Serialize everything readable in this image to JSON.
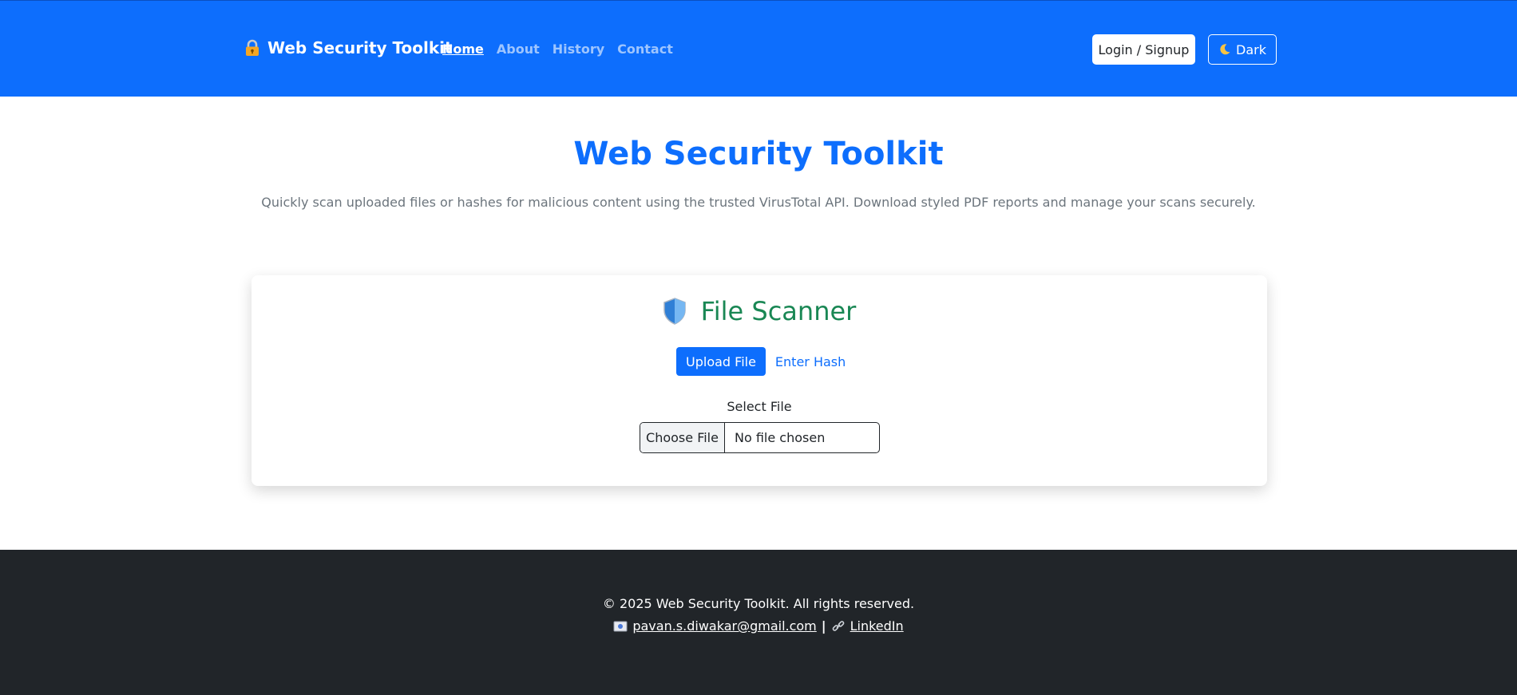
{
  "navbar": {
    "brand": "Web Security Toolkit",
    "links": [
      {
        "label": "Home",
        "active": true
      },
      {
        "label": "About",
        "active": false
      },
      {
        "label": "History",
        "active": false
      },
      {
        "label": "Contact",
        "active": false
      }
    ],
    "login_label": "Login / Signup",
    "theme_label": "Dark"
  },
  "hero": {
    "title": "Web Security Toolkit",
    "subtitle": "Quickly scan uploaded files or hashes for malicious content using the trusted VirusTotal API. Download styled PDF reports and manage your scans securely."
  },
  "scanner": {
    "title": "File Scanner",
    "tabs": [
      {
        "label": "Upload File",
        "active": true
      },
      {
        "label": "Enter Hash",
        "active": false
      }
    ],
    "field_label": "Select File",
    "choose_label": "Choose File",
    "file_status": "No file chosen"
  },
  "footer": {
    "copyright": "© 2025 Web Security Toolkit. All rights reserved.",
    "email": "pavan.s.diwakar@gmail.com",
    "separator": "|",
    "linkedin": "LinkedIn"
  },
  "colors": {
    "primary": "#0d6efd",
    "success": "#198754",
    "footer_bg": "#212529",
    "muted": "#6c757d"
  },
  "icons": {
    "brand": "lock-icon",
    "theme": "moon-icon",
    "scanner": "shield-icon",
    "email": "mail-icon",
    "linkedin": "link-icon"
  }
}
